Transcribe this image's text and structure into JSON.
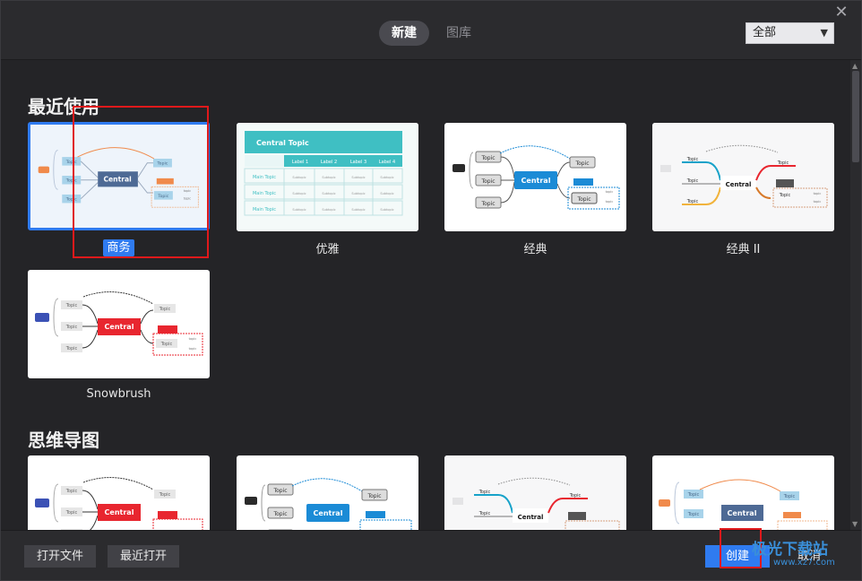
{
  "header": {
    "tabs": [
      {
        "label": "新建",
        "active": true
      },
      {
        "label": "图库",
        "active": false
      }
    ],
    "filter": {
      "selected": "全部"
    }
  },
  "sections": [
    {
      "title": "最近使用",
      "templates": [
        {
          "label": "商务",
          "selected": true
        },
        {
          "label": "优雅",
          "selected": false
        },
        {
          "label": "经典",
          "selected": false
        },
        {
          "label": "经典 II",
          "selected": false
        },
        {
          "label": "Snowbrush",
          "selected": false
        }
      ]
    },
    {
      "title": "思维导图",
      "templates": []
    }
  ],
  "preview_text": {
    "central": "Central",
    "topic": "Topic",
    "central_topic": "Central Topic",
    "main_topic": "Main Topic",
    "subtopic": "Subtopic",
    "labels": [
      "Label 1",
      "Label 2",
      "Label 3",
      "Label 4"
    ]
  },
  "footer": {
    "open_file": "打开文件",
    "recent_open": "最近打开",
    "create": "创建",
    "cancel": "取消"
  },
  "watermark": {
    "name": "极光下载站",
    "url": "www.xz7.com"
  },
  "colors": {
    "accent": "#2f7bf0",
    "business_central": "#4e6a95",
    "elegant_header": "#3fbfc3",
    "classic_central": "#1b8bd6",
    "snowbrush_central": "#e8262f"
  }
}
